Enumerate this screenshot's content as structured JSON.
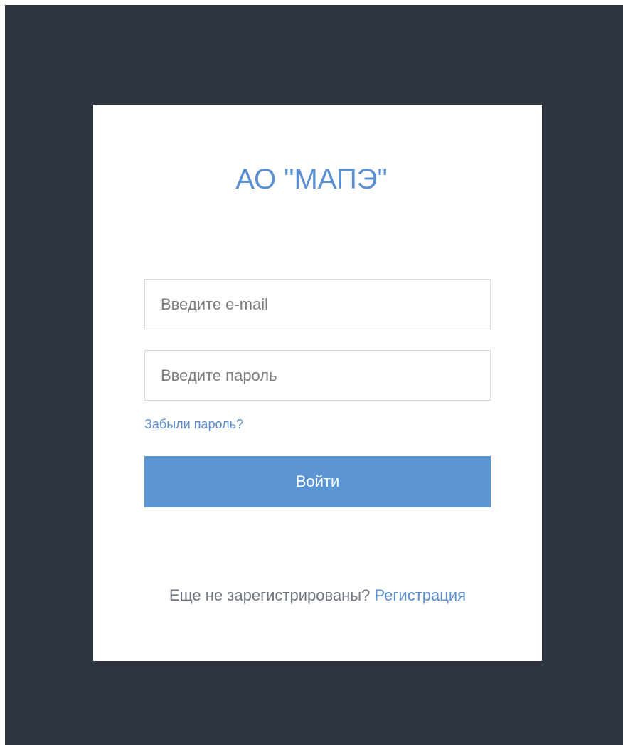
{
  "brand": {
    "title": "АО \"МАПЭ\""
  },
  "login_form": {
    "email_placeholder": "Введите e-mail",
    "password_placeholder": "Введите пароль",
    "forgot_password": "Забыли пароль?",
    "submit_label": "Войти"
  },
  "signup": {
    "prompt": "Еще не зарегистрированы?",
    "link": "Регистрация"
  },
  "colors": {
    "background": "#2e3440",
    "card": "#ffffff",
    "accent": "#5b8fd1",
    "button": "#5b95d4"
  }
}
